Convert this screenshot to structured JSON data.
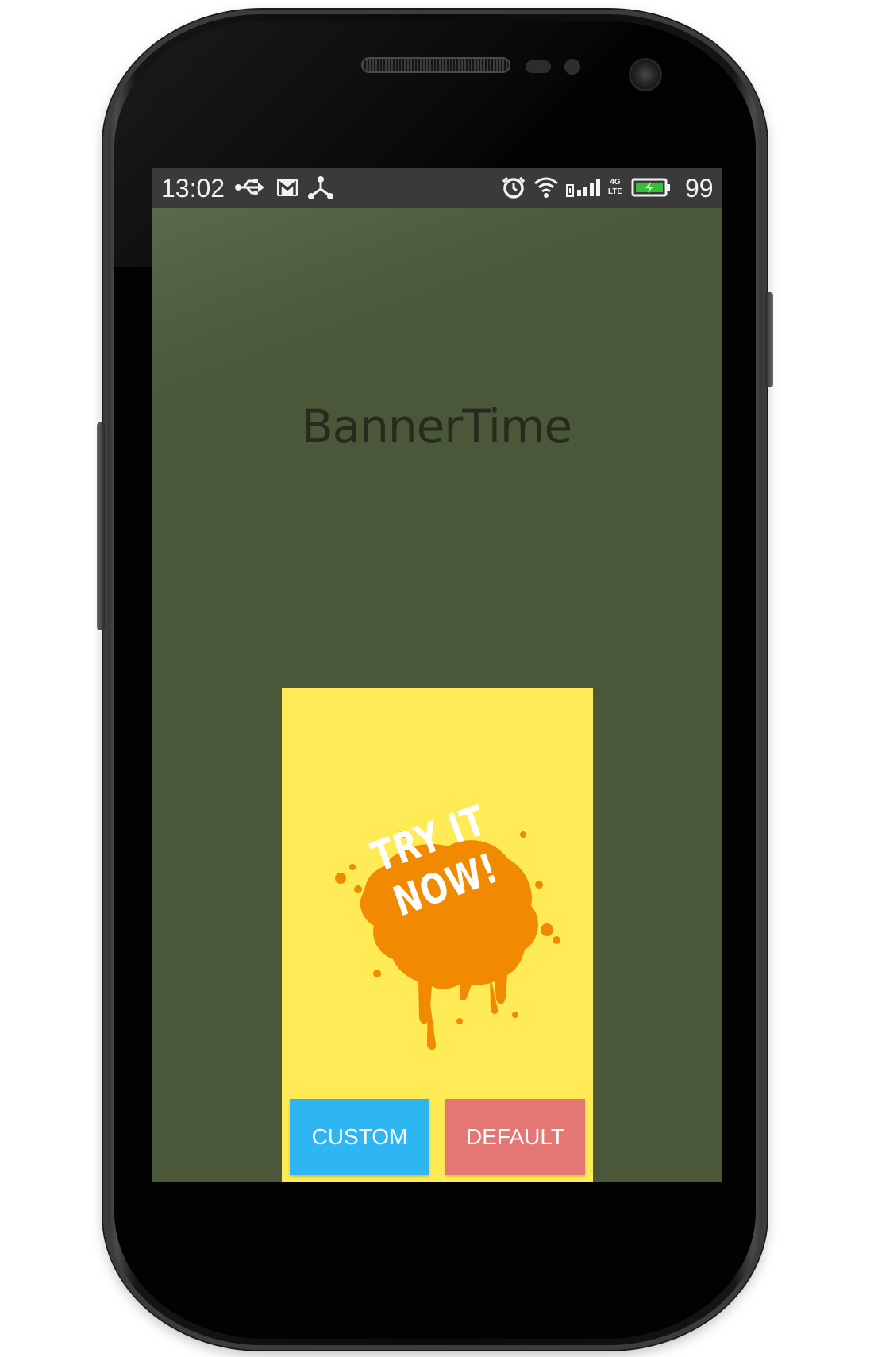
{
  "status_bar": {
    "time": "13:02",
    "battery_percent": "99",
    "icons_left": [
      "usb-icon",
      "gmail-icon",
      "share-icon"
    ],
    "icons_right": [
      "alarm-icon",
      "wifi-icon",
      "signal-icon",
      "network-4g-lte-icon",
      "battery-charging-icon"
    ],
    "network_label_top": "4G",
    "network_label_bottom": "LTE"
  },
  "app": {
    "title": "BannerTime"
  },
  "banner": {
    "background_color": "#ffeb55",
    "splash_color": "#f18a00",
    "splash_text_line1": "TRY IT",
    "splash_text_line2": "NOW!",
    "buttons": {
      "custom_label": "CUSTOM",
      "custom_color": "#2db6f2",
      "default_label": "DEFAULT",
      "default_color": "#e47673"
    }
  },
  "colors": {
    "screen_background": "#4a5738",
    "status_bar_background": "#3a3a3a"
  }
}
